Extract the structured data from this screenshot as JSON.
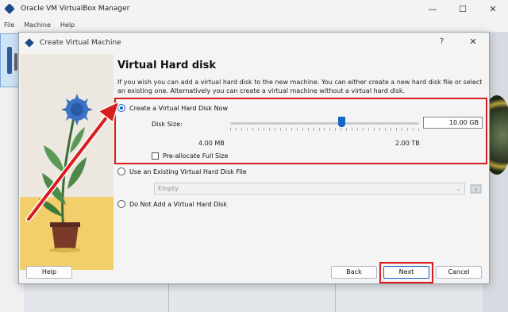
{
  "main_window": {
    "title": "Oracle VM VirtualBox Manager",
    "menu": [
      "File",
      "Machine",
      "Help"
    ],
    "controls": [
      "—",
      "☐",
      "✕"
    ]
  },
  "dialog": {
    "title": "Create Virtual Machine",
    "help_glyph": "?",
    "close_glyph": "✕",
    "heading": "Virtual Hard disk",
    "description": "If you wish you can add a virtual hard disk to the new machine. You can either create a new hard disk file or select an existing one. Alternatively you can create a virtual machine without a virtual hard disk.",
    "options": {
      "create_new": {
        "label": "Create a Virtual Hard Disk Now",
        "checked": true
      },
      "use_existing": {
        "label": "Use an Existing Virtual Hard Disk File",
        "checked": false
      },
      "no_disk": {
        "label": "Do Not Add a Virtual Hard Disk",
        "checked": false
      }
    },
    "disk_size": {
      "label": "Disk Size:",
      "value": "10.00 GB",
      "min_label": "4.00 MB",
      "max_label": "2.00 TB",
      "slider_fraction": 0.59
    },
    "preallocate": {
      "label": "Pre-allocate Full Size",
      "checked": false
    },
    "existing_file": {
      "value": "Empty"
    },
    "buttons": {
      "help": "Help",
      "back": "Back",
      "next": "Next",
      "cancel": "Cancel"
    }
  },
  "colors": {
    "accent": "#1763c6",
    "annotation_red": "#d71d1d"
  }
}
